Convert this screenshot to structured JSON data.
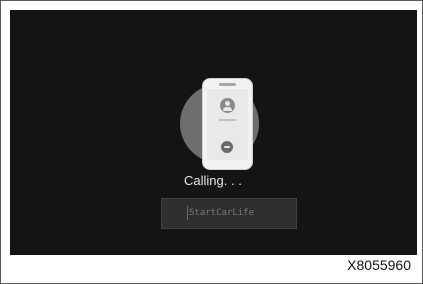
{
  "call_screen": {
    "status": "Calling. . .",
    "start_button_label": "StartCarLife"
  },
  "figure": {
    "reference_code": "X8055960"
  },
  "icons": {
    "phone": "smartphone-icon",
    "contact": "person-icon",
    "hangup": "hangup-icon"
  },
  "colors": {
    "screen_background": "#141414",
    "circle": "#6e6e6e",
    "phone_body": "#f2f2f2",
    "button_background": "#2f2f2f"
  }
}
